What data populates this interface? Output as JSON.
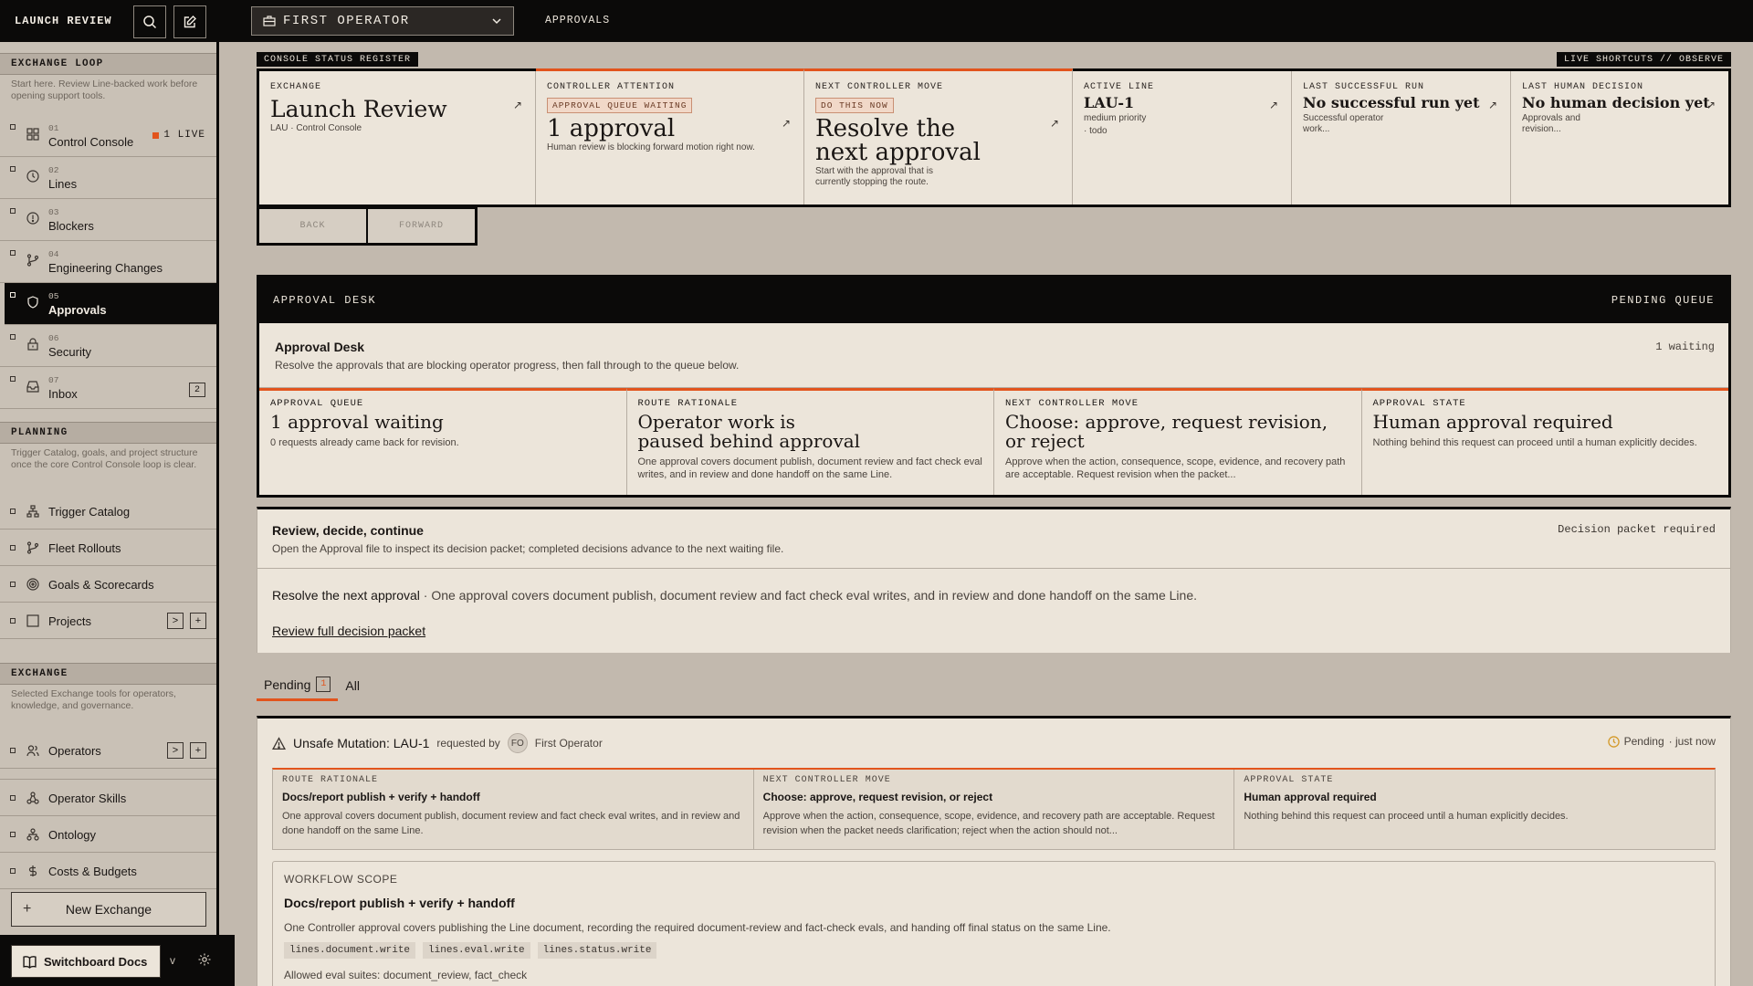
{
  "sidebar": {
    "app_title": "LAUNCH REVIEW",
    "sections": {
      "exchange_loop": {
        "title": "EXCHANGE LOOP",
        "description": "Start here. Review Line-backed work before opening support tools.",
        "items": [
          {
            "num": "01",
            "label": "Control Console",
            "live": "1 LIVE"
          },
          {
            "num": "02",
            "label": "Lines"
          },
          {
            "num": "03",
            "label": "Blockers"
          },
          {
            "num": "04",
            "label": "Engineering Changes"
          },
          {
            "num": "05",
            "label": "Approvals"
          },
          {
            "num": "06",
            "label": "Security"
          },
          {
            "num": "07",
            "label": "Inbox",
            "count": "2"
          }
        ]
      },
      "planning": {
        "title": "PLANNING",
        "description": "Trigger Catalog, goals, and project structure once the core Control Console loop is clear.",
        "items": [
          {
            "label": "Trigger Catalog"
          },
          {
            "label": "Fleet Rollouts"
          },
          {
            "label": "Goals & Scorecards"
          },
          {
            "label": "Projects"
          }
        ]
      },
      "exchange": {
        "title": "EXCHANGE",
        "description": "Selected Exchange tools for operators, knowledge, and governance.",
        "items": [
          {
            "label": "Operators"
          },
          {
            "label": "Operator Skills"
          },
          {
            "label": "Ontology"
          },
          {
            "label": "Costs & Budgets"
          }
        ]
      }
    },
    "new_exchange": "New Exchange",
    "docs": "Switchboard Docs",
    "version": "v"
  },
  "topbar": {
    "operator": "FIRST OPERATOR",
    "breadcrumb": "APPROVALS"
  },
  "status_register": {
    "tag": "CONSOLE STATUS REGISTER",
    "shortcuts": "LIVE SHORTCUTS // OBSERVE",
    "exchange": {
      "label": "EXCHANGE",
      "title": "Launch Review",
      "sub": "LAU · Control Console"
    },
    "attention": {
      "label": "CONTROLLER ATTENTION",
      "chip": "APPROVAL QUEUE WAITING",
      "title": "1 approval",
      "sub": "Human review is blocking forward motion right now."
    },
    "next_move": {
      "label": "NEXT CONTROLLER MOVE",
      "chip": "DO THIS NOW",
      "title": "Resolve the next approval",
      "sub": "Start with the approval that is currently stopping the route."
    },
    "active_line": {
      "label": "ACTIVE LINE",
      "title": "LAU-1",
      "sub1": "medium priority",
      "sub2": "· todo"
    },
    "last_run": {
      "label": "LAST SUCCESSFUL RUN",
      "title": "No successful run yet",
      "sub": "Successful operator work..."
    },
    "last_decision": {
      "label": "LAST HUMAN DECISION",
      "title": "No human decision yet",
      "sub": "Approvals and revision..."
    },
    "back": "BACK",
    "forward": "FORWARD"
  },
  "desk": {
    "head_left": "APPROVAL DESK",
    "head_right": "PENDING QUEUE",
    "title": "Approval Desk",
    "description": "Resolve the approvals that are blocking operator progress, then fall through to the queue below.",
    "count": "1 waiting",
    "cards": [
      {
        "label": "APPROVAL QUEUE",
        "title": "1 approval waiting",
        "sub": "0 requests already came back for revision."
      },
      {
        "label": "ROUTE RATIONALE",
        "title": "Operator work is paused behind approval",
        "sub": "One approval covers document publish, document review and fact check eval writes, and in review and done handoff on the same Line."
      },
      {
        "label": "NEXT CONTROLLER MOVE",
        "title": "Choose: approve, request revision, or reject",
        "sub": "Approve when the action, consequence, scope, evidence, and recovery path are acceptable. Request revision when the packet..."
      },
      {
        "label": "APPROVAL STATE",
        "title": "Human approval required",
        "sub": "Nothing behind this request can proceed until a human explicitly decides."
      }
    ]
  },
  "review": {
    "title": "Review, decide, continue",
    "description": "Open the Approval file to inspect its decision packet; completed decisions advance to the next waiting file.",
    "right": "Decision packet required",
    "line_title": "Resolve the next approval",
    "line_text": " · One approval covers document publish, document review and fact check eval writes, and in review and done handoff on the same Line.",
    "link": "Review full decision packet"
  },
  "tabs": {
    "pending": "Pending",
    "pending_count": "1",
    "all": "All"
  },
  "approval": {
    "title": "Unsafe Mutation: LAU-1",
    "requested_by": "requested by",
    "avatar": "FO",
    "requester": "First Operator",
    "status": "Pending",
    "time": "· just now",
    "cards": [
      {
        "label": "ROUTE RATIONALE",
        "title": "Docs/report publish + verify + handoff",
        "sub": "One approval covers document publish, document review and fact check eval writes, and in review and done handoff on the same Line."
      },
      {
        "label": "NEXT CONTROLLER MOVE",
        "title": "Choose: approve, request revision, or reject",
        "sub": "Approve when the action, consequence, scope, evidence, and recovery path are acceptable. Request revision when the packet needs clarification; reject when the action should not..."
      },
      {
        "label": "APPROVAL STATE",
        "title": "Human approval required",
        "sub": "Nothing behind this request can proceed until a human explicitly decides."
      }
    ],
    "scope": {
      "label": "WORKFLOW SCOPE",
      "title": "Docs/report publish + verify + handoff",
      "description": "One Controller approval covers publishing the Line document, recording the required document-review and fact-check evals, and handing off final status on the same Line.",
      "pills": [
        "lines.document.write",
        "lines.eval.write",
        "lines.status.write"
      ],
      "evals": "Allowed eval suites: document_review, fact_check"
    }
  },
  "colors": {
    "accent": "#e2541d",
    "ink": "#0b0a09",
    "paper": "#ece5da",
    "background": "#c2b9ae"
  }
}
